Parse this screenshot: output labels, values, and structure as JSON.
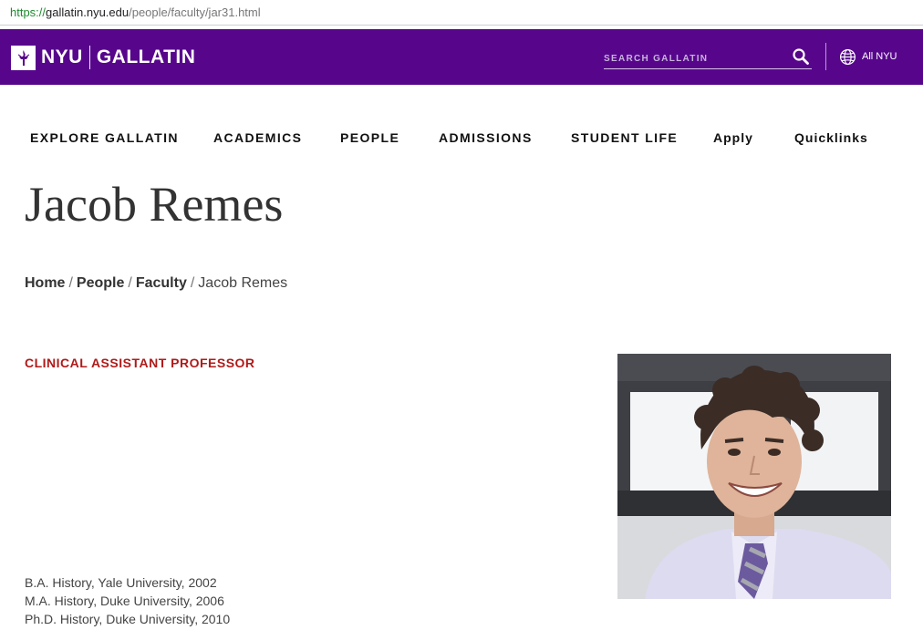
{
  "browser": {
    "url_scheme": "https://",
    "url_host": "gallatin.nyu.edu",
    "url_path": "/people/faculty/jar31.html"
  },
  "header": {
    "logo_nyu": "NYU",
    "logo_gallatin": "GALLATIN",
    "search_placeholder": "SEARCH GALLATIN",
    "all_nyu_label": "All NYU",
    "brand_color": "#57068c"
  },
  "nav": {
    "items": [
      {
        "label": "EXPLORE GALLATIN"
      },
      {
        "label": "ACADEMICS"
      },
      {
        "label": "PEOPLE"
      },
      {
        "label": "ADMISSIONS"
      },
      {
        "label": "STUDENT LIFE"
      },
      {
        "label": "Apply"
      },
      {
        "label": "Quicklinks"
      }
    ]
  },
  "page": {
    "title": "Jacob Remes",
    "breadcrumb": {
      "home": "Home",
      "people": "People",
      "faculty": "Faculty",
      "current": "Jacob Remes",
      "separator": "/"
    },
    "role": "CLINICAL ASSISTANT PROFESSOR",
    "role_color": "#b01a1a",
    "education": [
      "B.A. History, Yale University, 2002",
      "M.A. History, Duke University, 2006",
      "Ph.D. History, Duke University, 2010"
    ]
  }
}
